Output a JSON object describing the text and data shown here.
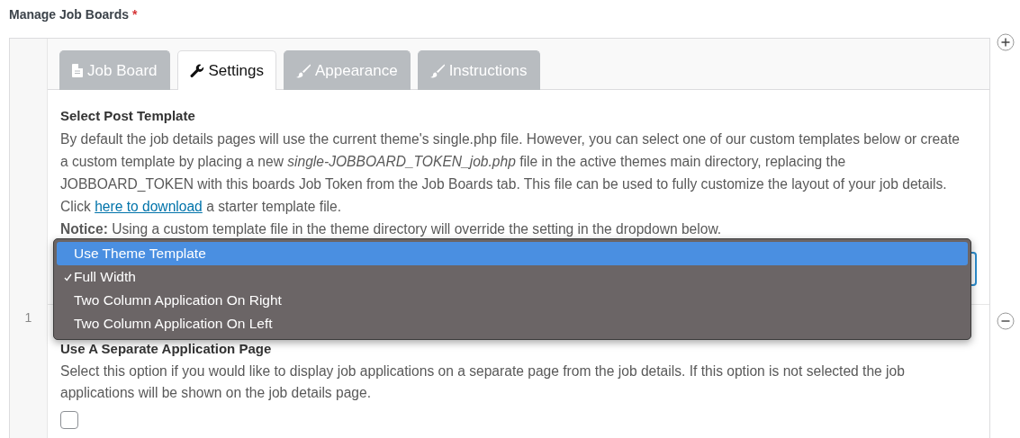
{
  "field_label": {
    "text": "Manage Job Boards",
    "required_mark": "*"
  },
  "row_number": "1",
  "tabs": [
    {
      "label": "Job Board",
      "selected": false
    },
    {
      "label": "Settings",
      "selected": true
    },
    {
      "label": "Appearance",
      "selected": false
    },
    {
      "label": "Instructions",
      "selected": false
    }
  ],
  "template_section": {
    "title": "Select Post Template",
    "description": "By default the job details pages will use the current theme's single.php file. However, you can select one of our custom templates below or create a custom template by placing a new *single-JOBBOARD_TOKEN_job.php* file in the active themes main directory, replacing the JOBBOARD_TOKEN with this boards Job Token from the Job Boards tab. This file can be used to fully customize the layout of your job details. Click",
    "link": "here to download",
    "link_suffix": "a starter template file.",
    "notice": "**Notice:** Using a custom template file in the theme directory will override the setting in the dropdown below.",
    "dropdown": {
      "expanded": true,
      "options": [
        {
          "label": "Use Theme Template",
          "highlighted": true,
          "checked": false
        },
        {
          "label": "Full Width",
          "highlighted": false,
          "checked": true
        },
        {
          "label": "Two Column Application On Right",
          "highlighted": false,
          "checked": false
        },
        {
          "label": "Two Column Application On Left",
          "highlighted": false,
          "checked": false
        }
      ]
    }
  },
  "application_section": {
    "title": "Use A Separate Application Page",
    "description": "Select this option if you would like to display job applications on a separate page from the job details. If this option is not selected the job applications will be shown on the job details page.",
    "checkbox": {
      "checked": false
    }
  }
}
